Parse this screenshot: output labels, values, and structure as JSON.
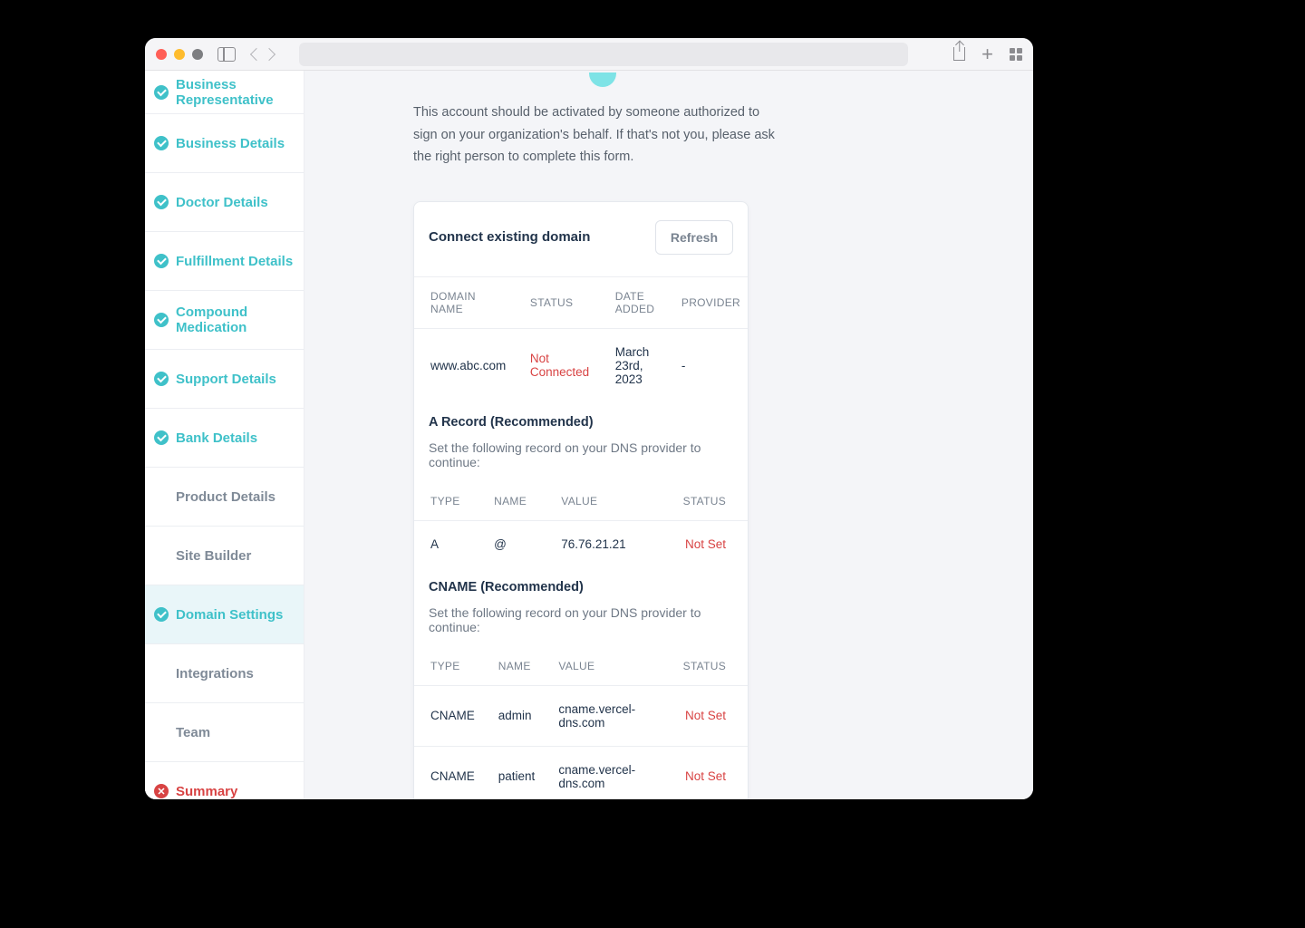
{
  "sidebar": {
    "items": [
      {
        "label": "Business Representative",
        "state": "completed"
      },
      {
        "label": "Business Details",
        "state": "completed"
      },
      {
        "label": "Doctor Details",
        "state": "completed"
      },
      {
        "label": "Fulfillment Details",
        "state": "completed"
      },
      {
        "label": "Compound Medication",
        "state": "completed"
      },
      {
        "label": "Support Details",
        "state": "completed"
      },
      {
        "label": "Bank Details",
        "state": "completed"
      },
      {
        "label": "Product Details",
        "state": "pending"
      },
      {
        "label": "Site Builder",
        "state": "pending"
      },
      {
        "label": "Domain Settings",
        "state": "active"
      },
      {
        "label": "Integrations",
        "state": "pending"
      },
      {
        "label": "Team",
        "state": "pending"
      },
      {
        "label": "Summary",
        "state": "error"
      }
    ]
  },
  "intro_text": "This account should be activated by someone authorized to sign on your organization's behalf. If that's not you, please ask the right person to complete this form.",
  "card": {
    "title": "Connect existing domain",
    "refresh": "Refresh",
    "columns": {
      "domain": "DOMAIN NAME",
      "status": "STATUS",
      "date": "DATE ADDED",
      "provider": "PROVIDER"
    },
    "row": {
      "domain": "www.abc.com",
      "status": "Not Connected",
      "date": "March 23rd, 2023",
      "provider": "-"
    }
  },
  "a_record": {
    "title": "A Record (Recommended)",
    "sub": "Set the following record on your DNS provider to continue:",
    "columns": {
      "type": "TYPE",
      "name": "NAME",
      "value": "VALUE",
      "status": "STATUS"
    },
    "row": {
      "type": "A",
      "name": "@",
      "value": "76.76.21.21",
      "status": "Not Set"
    }
  },
  "cname": {
    "title": "CNAME (Recommended)",
    "sub": "Set the following record on your DNS provider to continue:",
    "columns": {
      "type": "TYPE",
      "name": "NAME",
      "value": "VALUE",
      "status": "STATUS"
    },
    "rows": [
      {
        "type": "CNAME",
        "name": "admin",
        "value": "cname.vercel-dns.com",
        "status": "Not Set"
      },
      {
        "type": "CNAME",
        "name": "patient",
        "value": "cname.vercel-dns.com",
        "status": "Not Set"
      }
    ]
  }
}
